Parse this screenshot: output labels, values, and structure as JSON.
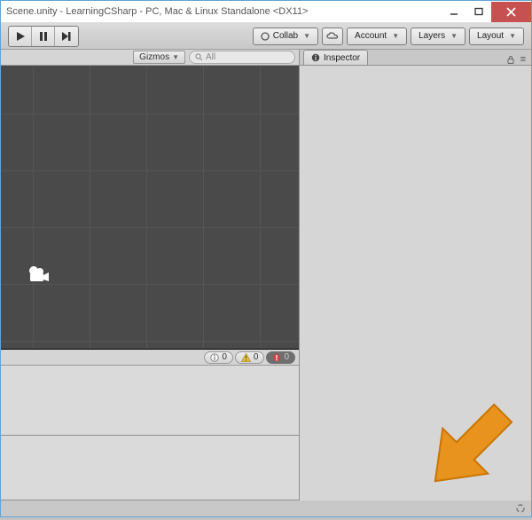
{
  "window": {
    "title": "Scene.unity - LearningCSharp - PC, Mac & Linux Standalone <DX11>"
  },
  "toolbar": {
    "collab": "Collab",
    "account": "Account",
    "layers": "Layers",
    "layout": "Layout"
  },
  "scene_tools": {
    "gizmos": "Gizmos",
    "search_placeholder": "All"
  },
  "console_counters": {
    "info": "0",
    "warn": "0",
    "error": "0"
  },
  "inspector": {
    "tab_label": "Inspector"
  }
}
